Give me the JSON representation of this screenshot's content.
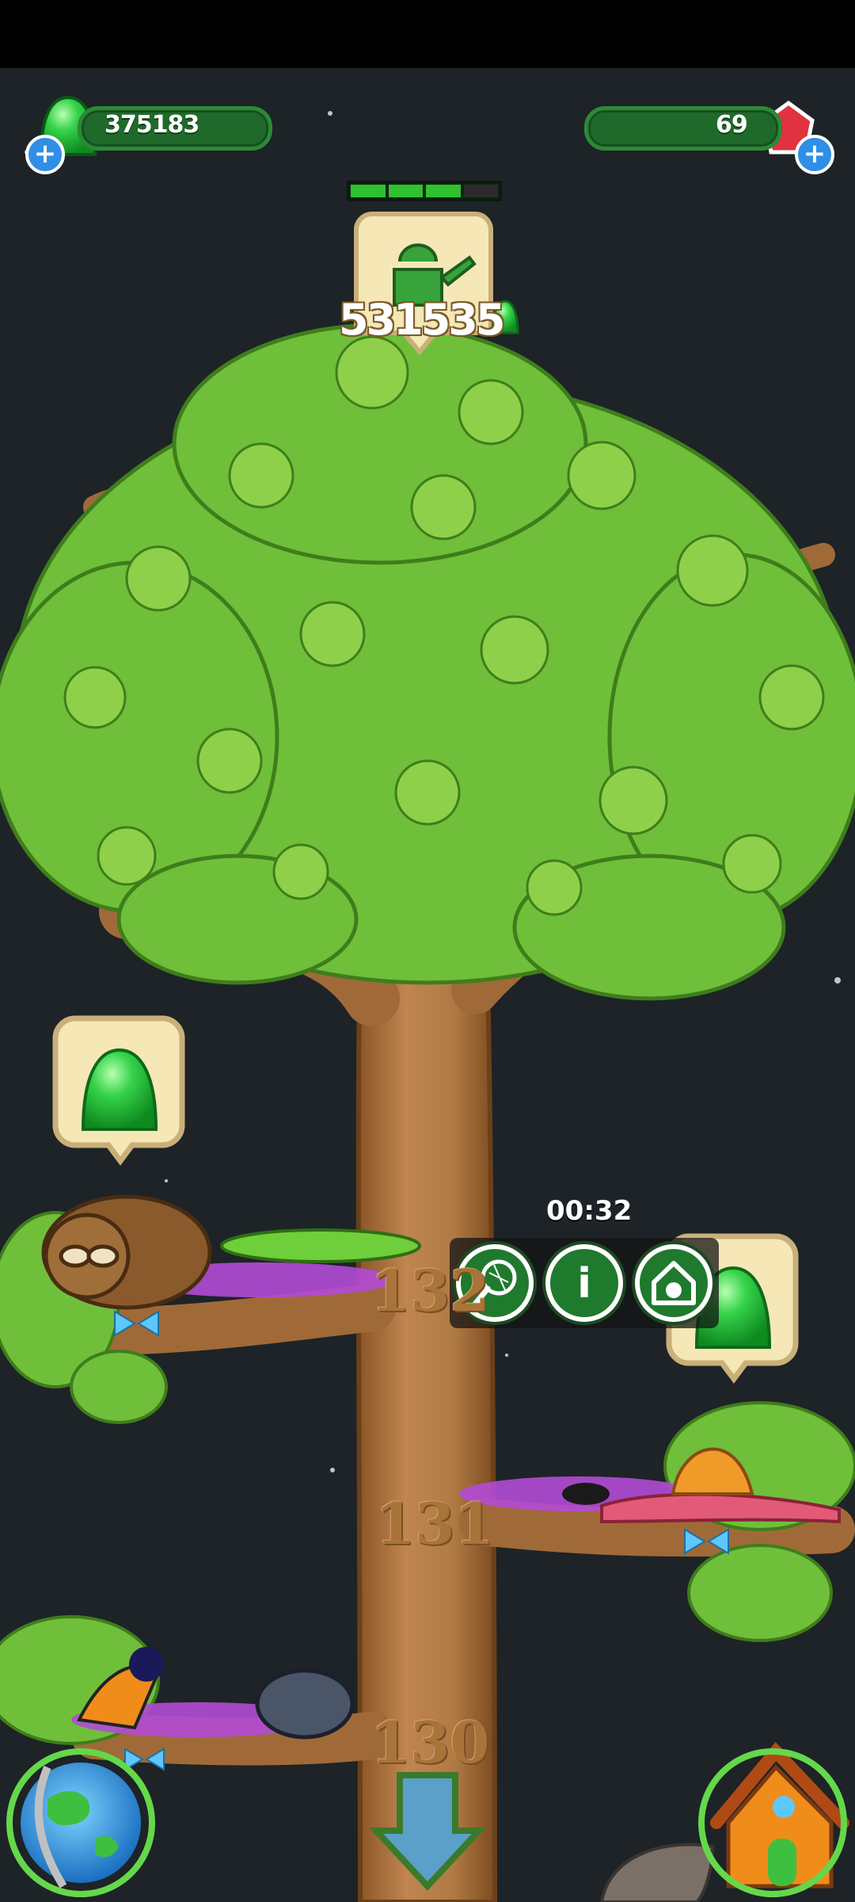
{
  "hud": {
    "jelly_count": "375183",
    "gem_count": "69"
  },
  "growth": {
    "progress_segments_filled": 3,
    "progress_segments_total": 4,
    "cost": "531535",
    "tool_icon": "watering-can-icon"
  },
  "selected_branch": {
    "timer": "00:32",
    "actions": [
      {
        "name": "catch-net-button",
        "icon": "net-icon"
      },
      {
        "name": "info-button",
        "icon": "info-icon",
        "glyph": "i"
      },
      {
        "name": "habitat-button",
        "icon": "pet-house-icon"
      }
    ]
  },
  "branches": [
    {
      "number": "132"
    },
    {
      "number": "131"
    },
    {
      "number": "130"
    }
  ],
  "bottom_nav": {
    "left": "globe-icon",
    "center": "scroll-down-arrow-icon",
    "right": "house-icon"
  },
  "colors": {
    "background": "#1d2327",
    "hud_bar": "#1f6a2a",
    "leaf": "#6fbf3a",
    "trunk": "#b07a44",
    "jelly": "#2fd14a"
  }
}
